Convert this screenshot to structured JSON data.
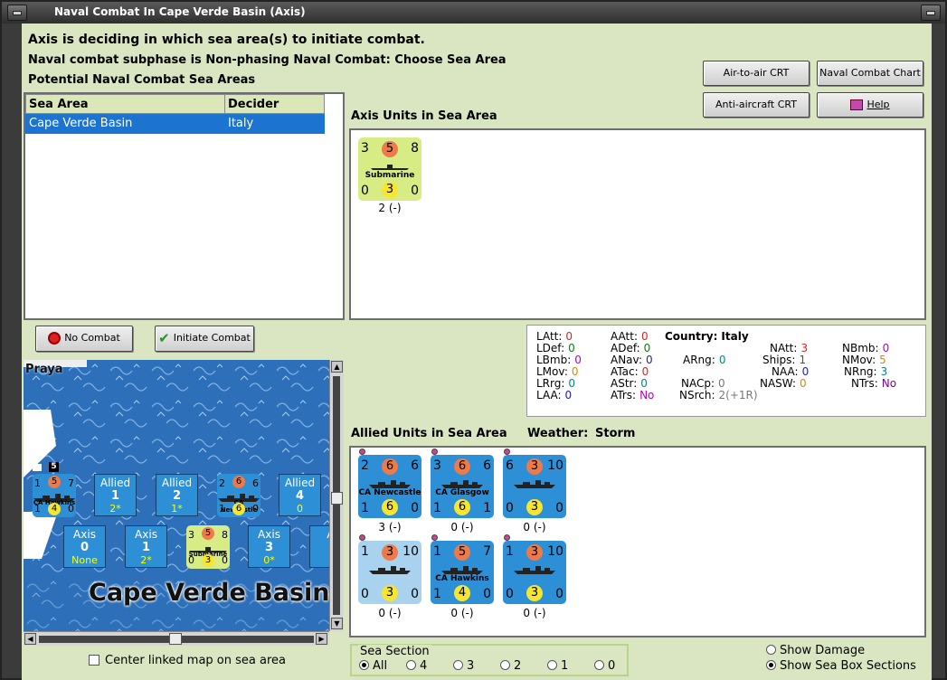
{
  "window": {
    "title": "Naval Combat In Cape Verde Basin (Axis)"
  },
  "header": {
    "line1": "Axis is deciding in which sea area(s) to initiate combat.",
    "line2": "Naval combat subphase is Non-phasing Naval Combat: Choose Sea Area",
    "line3": "Potential Naval Combat Sea Areas"
  },
  "buttons": {
    "air_to_air": "Air-to-air CRT",
    "naval_chart": "Naval Combat Chart",
    "anti_aircraft": "Anti-aircraft CRT",
    "help": "Help",
    "no_combat": "No Combat",
    "initiate_combat": "Initiate Combat"
  },
  "sea_table": {
    "headers": [
      "Sea Area",
      "Decider"
    ],
    "rows": [
      [
        "Cape Verde Basin",
        "Italy"
      ]
    ]
  },
  "axis_units": {
    "title": "Axis Units in Sea Area",
    "units": [
      {
        "tl": "3",
        "tm": "5",
        "tr": "8",
        "name": "Submarine",
        "bl": "0",
        "bm": "3",
        "br": "0",
        "under": "2 (-)"
      }
    ]
  },
  "stats": {
    "country_label": "Country:",
    "country": "Italy",
    "col1": [
      [
        "LAtt:",
        "0"
      ],
      [
        "LDef:",
        "0"
      ],
      [
        "LBmb:",
        "0"
      ],
      [
        "LMov:",
        "0"
      ],
      [
        "LRrg:",
        "0"
      ],
      [
        "LAA:",
        "0"
      ]
    ],
    "col2": [
      [
        "AAtt:",
        "0"
      ],
      [
        "ADef:",
        "0"
      ],
      [
        "ANav:",
        "0"
      ],
      [
        "ATac:",
        "0"
      ],
      [
        "AStr:",
        "0"
      ],
      [
        "ATrs:",
        "No"
      ]
    ],
    "arng": [
      "ARng:",
      "0"
    ],
    "nacp": [
      "NACp:",
      "0"
    ],
    "nsrch": [
      "NSrch:",
      "2(+1R)"
    ],
    "col4": [
      [
        "NAtt:",
        "3"
      ],
      [
        "Ships:",
        "1"
      ],
      [
        "NAA:",
        "0"
      ],
      [
        "NASW:",
        "0"
      ]
    ],
    "col5": [
      [
        "NBmb:",
        "0"
      ],
      [
        "NMov:",
        "5"
      ],
      [
        "NRng:",
        "3"
      ],
      [
        "NTrs:",
        "No"
      ]
    ]
  },
  "allied_units": {
    "title": "Allied Units in Sea Area",
    "weather_label": "Weather:",
    "weather": "Storm",
    "units": [
      {
        "tl": "2",
        "tm": "6",
        "tr": "6",
        "name": "CA Newcastle",
        "bl": "1",
        "bm": "6",
        "br": "0",
        "under": "3 (-)"
      },
      {
        "tl": "3",
        "tm": "6",
        "tr": "6",
        "name": "CA Glasgow",
        "bl": "1",
        "bm": "6",
        "br": "1",
        "under": "0 (-)"
      },
      {
        "tl": "6",
        "tm": "3",
        "tr": "10",
        "name": "",
        "bl": "0",
        "bm": "3",
        "br": "0",
        "under": "0 (-)"
      },
      {
        "tl": "1",
        "tm": "3",
        "tr": "10",
        "name": "",
        "bl": "0",
        "bm": "3",
        "br": "0",
        "under": "0 (-)"
      },
      {
        "tl": "1",
        "tm": "5",
        "tr": "7",
        "name": "CA Hawkins",
        "bl": "1",
        "bm": "4",
        "br": "0",
        "under": "0 (-)"
      },
      {
        "tl": "1",
        "tm": "3",
        "tr": "10",
        "name": "",
        "bl": "0",
        "bm": "3",
        "br": "0",
        "under": "0 (-)"
      }
    ]
  },
  "map": {
    "praya": "Praya",
    "sea_name": "Cape Verde Basin",
    "flag_num": "5",
    "allied_row": [
      {
        "type": "counter",
        "tl": "1",
        "tm": "5",
        "tr": "7",
        "name": "CA Hawkins",
        "bl": "1",
        "bm": "4",
        "br": "0"
      },
      {
        "type": "box",
        "label": "Allied",
        "value": "1",
        "sub": "2*"
      },
      {
        "type": "box",
        "label": "Allied",
        "value": "2",
        "sub": "1*"
      },
      {
        "type": "counter",
        "tl": "2",
        "tm": "6",
        "tr": "6",
        "name": "CA Newcastle",
        "bl": "1",
        "bm": "6",
        "br": "0"
      },
      {
        "type": "box",
        "label": "Allied",
        "value": "4",
        "sub": "0"
      }
    ],
    "axis_row": [
      {
        "type": "box",
        "label": "Axis",
        "value": "0",
        "sub": "None"
      },
      {
        "type": "box",
        "label": "Axis",
        "value": "1",
        "sub": "2*"
      },
      {
        "type": "counter",
        "tl": "3",
        "tm": "5",
        "tr": "8",
        "name": "Submarine",
        "bl": "0",
        "bm": "3",
        "br": "0"
      },
      {
        "type": "box",
        "label": "Axis",
        "value": "3",
        "sub": "0*"
      },
      {
        "type": "box",
        "label": "A",
        "value": "",
        "sub": ""
      }
    ]
  },
  "center_linked": "Center linked map on sea area",
  "sea_section": {
    "label": "Sea Section",
    "options": [
      "All",
      "4",
      "3",
      "2",
      "1",
      "0"
    ],
    "selected": "All"
  },
  "display": {
    "show_damage": "Show Damage",
    "show_sections": "Show Sea Box Sections"
  },
  "colors": {
    "panel_bg": "#dae6c2",
    "selection": "#1c74d0",
    "axis_counter": "#d8ec86",
    "allied_counter": "#2d8fd5"
  }
}
